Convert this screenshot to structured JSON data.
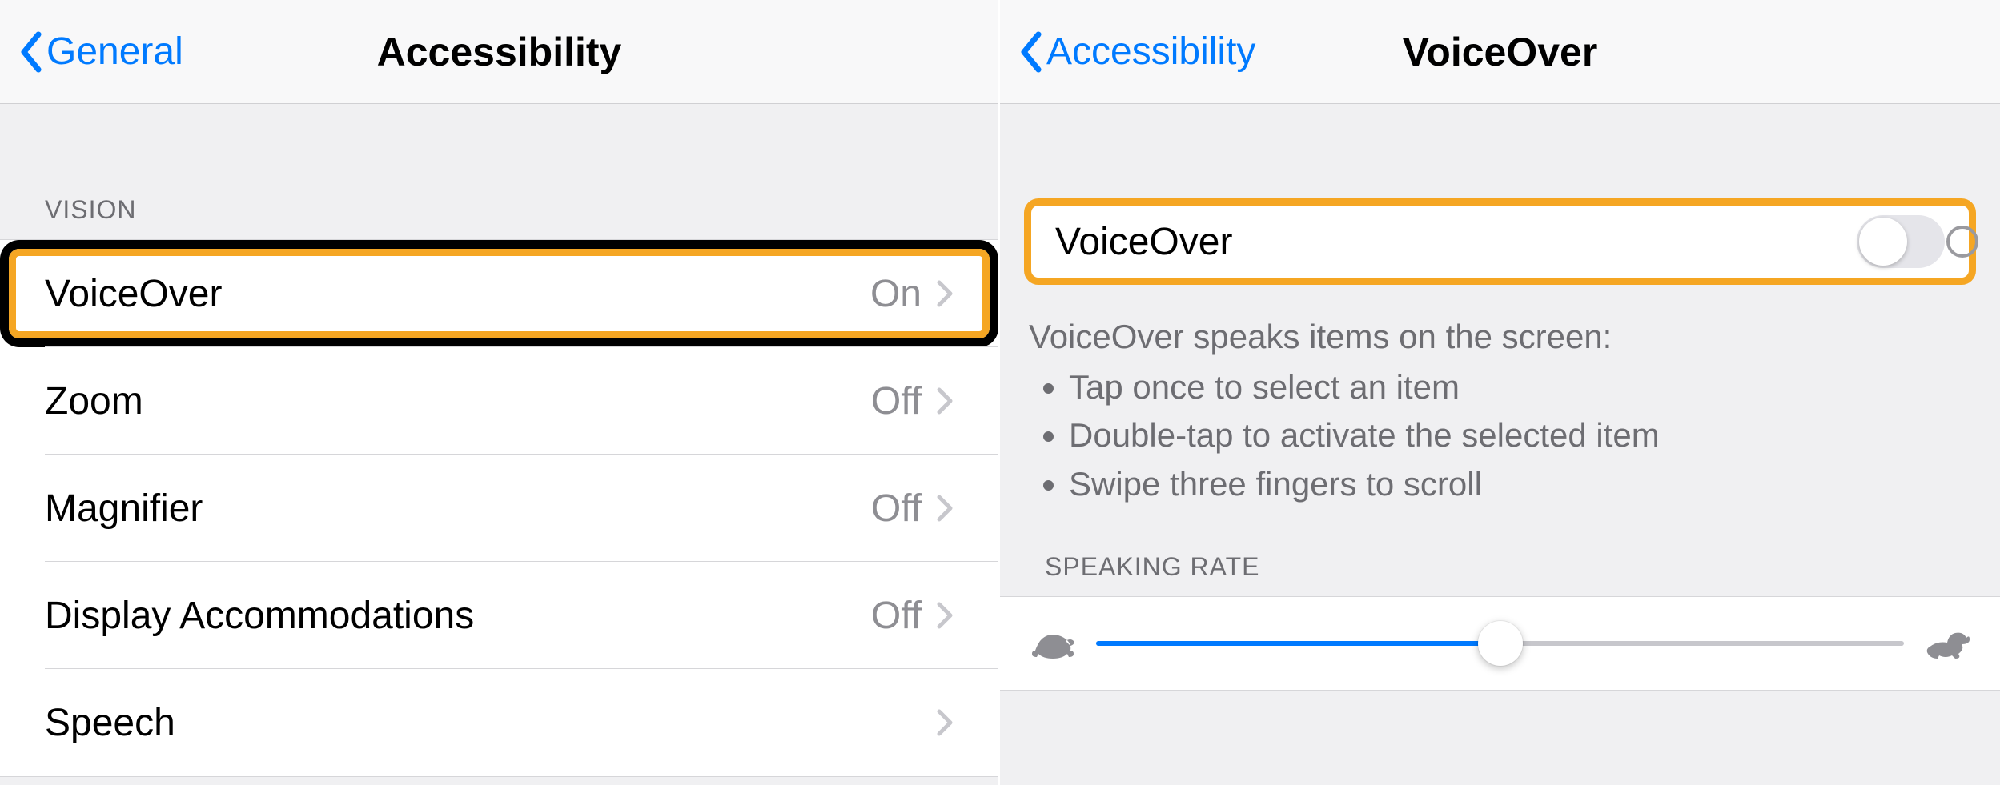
{
  "left": {
    "back_label": "General",
    "title": "Accessibility",
    "section_header": "VISION",
    "rows": [
      {
        "label": "VoiceOver",
        "value": "On",
        "highlight": true
      },
      {
        "label": "Zoom",
        "value": "Off"
      },
      {
        "label": "Magnifier",
        "value": "Off"
      },
      {
        "label": "Display Accommodations",
        "value": "Off"
      },
      {
        "label": "Speech",
        "value": ""
      }
    ]
  },
  "right": {
    "back_label": "Accessibility",
    "title": "VoiceOver",
    "toggle": {
      "label": "VoiceOver",
      "on": false
    },
    "help_heading": "VoiceOver speaks items on the screen:",
    "help_bullets": [
      "Tap once to select an item",
      "Double-tap to activate the selected item",
      "Swipe three fingers to scroll"
    ],
    "rate_header": "SPEAKING RATE",
    "rate_value_percent": 50
  },
  "colors": {
    "accent": "#007aff",
    "highlight": "#f5a623"
  }
}
